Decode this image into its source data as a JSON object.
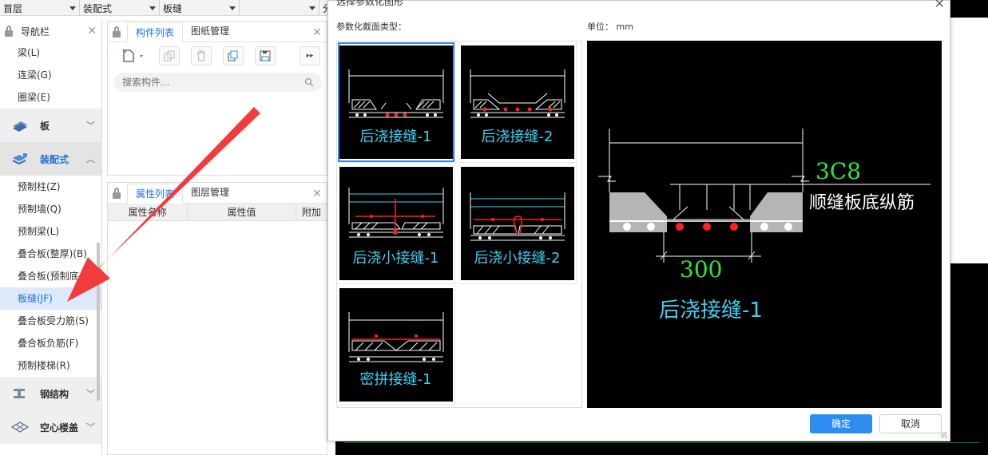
{
  "topbar": {
    "floor": "首层",
    "category": "装配式",
    "component": "板缝",
    "extra": "分"
  },
  "nav": {
    "title": "导航栏",
    "items_top": [
      "梁(L)",
      "连梁(G)",
      "圈梁(E)"
    ],
    "group_slab": "板",
    "group_prefab": "装配式",
    "items_prefab": [
      "预制柱(Z)",
      "预制墙(Q)",
      "预制梁(L)",
      "叠合板(整厚)(B)",
      "叠合板(预制底",
      "板缝(JF)",
      "叠合板受力筋(S)",
      "叠合板负筋(F)",
      "预制楼梯(R)"
    ],
    "group_steel": "钢结构",
    "group_hollow": "空心楼盖"
  },
  "complist": {
    "tab_components": "构件列表",
    "tab_drawings": "图纸管理",
    "search_placeholder": "搜索构件..."
  },
  "props": {
    "tab_props": "属性列表",
    "tab_layers": "图层管理",
    "col_name": "属性名称",
    "col_value": "属性值",
    "col_extra": "附加"
  },
  "dialog": {
    "title": "选择参数化图形",
    "section_label": "参数化截面类型：",
    "unit_label": "单位：  mm",
    "thumbs": [
      "后浇接缝-1",
      "后浇接缝-2",
      "后浇小接缝-1",
      "后浇小接缝-2",
      "密拼接缝-1"
    ],
    "preview": {
      "rebar": "3C8",
      "rebar_desc": "顺缝板底纵筋",
      "width": "300",
      "name": "后浇接缝-1"
    },
    "ok": "确定",
    "cancel": "取消"
  },
  "colors": {
    "accent": "#2d8cf0",
    "arrow": "#f03c3c",
    "cad_cyan": "#3dd1f0",
    "cad_green": "#2ee82e",
    "cad_red": "#ff2020"
  }
}
